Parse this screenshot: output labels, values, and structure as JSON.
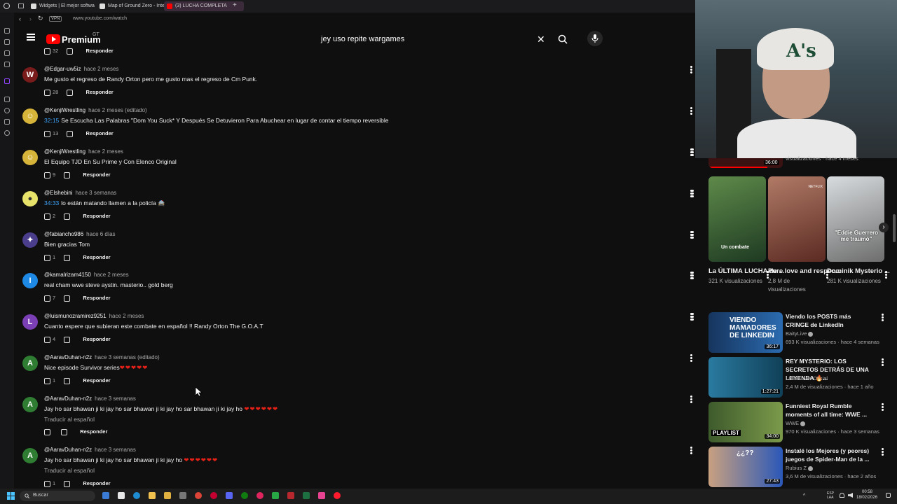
{
  "browser": {
    "tabs": [
      {
        "label": "Widgets | El mejor softwa",
        "color": "#e6e6e6"
      },
      {
        "label": "Map of Ground Zero - Inte",
        "color": "#e6e6e6"
      },
      {
        "label": "(3) LUCHA COMPLETA",
        "color": "#ff0000"
      }
    ],
    "vpn": "VPN",
    "url": "www.youtube.com/watch"
  },
  "header": {
    "logo_text": "Premium",
    "logo_sup": "GT",
    "search_value": "jey uso repite wargames",
    "clear_icon": "✕",
    "mic_icon": "🎤"
  },
  "comments": [
    {
      "author": "@Edgar-uw5iz",
      "time": "hace 2 meses",
      "timestamp": "",
      "text": "Me gusto el regreso de Randy Orton pero me gusto mas el regreso de Cm Punk.",
      "likes": "28",
      "reply": "Responder",
      "avatar_letter": "W",
      "avatar_color": "#7a1b1b"
    },
    {
      "author": "@KenjiWrestling",
      "time": "hace 2 meses (editado)",
      "timestamp": "32:15",
      "text": "Se Escucha Las Palabras \"Dom You Suck* Y Después Se Detuvieron Para Abuchear en lugar de contar el tiempo reversible",
      "likes": "13",
      "reply": "Responder",
      "avatar_letter": "☺",
      "avatar_color": "#d6b43a"
    },
    {
      "author": "@KenjiWrestling",
      "time": "hace 2 meses",
      "timestamp": "",
      "text": "El Equipo TJD En Su Prime y Con Elenco Original",
      "likes": "9",
      "reply": "Responder",
      "avatar_letter": "☺",
      "avatar_color": "#d6b43a"
    },
    {
      "author": "@Elshebini",
      "time": "hace 3 semanas",
      "timestamp": "34:33",
      "text": "lo están matando llamen a la policía 🚔",
      "likes": "2",
      "reply": "Responder",
      "avatar_letter": "●",
      "avatar_color": "#e7e26a"
    },
    {
      "author": "@fabiancho986",
      "time": "hace 6 días",
      "timestamp": "",
      "text": "Bien gracias Tom",
      "likes": "1",
      "reply": "Responder",
      "avatar_letter": "✦",
      "avatar_color": "#4a3e8c"
    },
    {
      "author": "@kamalrizam4150",
      "time": "hace 2 meses",
      "timestamp": "",
      "text": "real cham wwe steve aystin. masterio.. gold berg",
      "likes": "7",
      "reply": "Responder",
      "avatar_letter": "I",
      "avatar_color": "#1e88e5"
    },
    {
      "author": "@luismunozramirez9251",
      "time": "hace 2 meses",
      "timestamp": "",
      "text": "Cuanto espere que subieran este combate en español !! Randy Orton The G.O.A.T",
      "likes": "4",
      "reply": "Responder",
      "avatar_letter": "L",
      "avatar_color": "#7b3fb5"
    },
    {
      "author": "@AaravDuhan-n2z",
      "time": "hace 3 semanas (editado)",
      "timestamp": "",
      "text": "Nice episode Survivor series",
      "hearts": "❤❤❤❤❤",
      "likes": "1",
      "reply": "Responder",
      "avatar_letter": "A",
      "avatar_color": "#2e7d32"
    },
    {
      "author": "@AaravDuhan-n2z",
      "time": "hace 3 semanas",
      "timestamp": "",
      "text": "Jay ho sar bhawan ji ki jay ho sar bhawan ji ki jay ho sar bhawan ji ki jay ho",
      "hearts": "❤❤❤❤❤❤",
      "translate": "Traducir al español",
      "likes": "",
      "reply": "Responder",
      "avatar_letter": "A",
      "avatar_color": "#2e7d32"
    },
    {
      "author": "@AaravDuhan-n2z",
      "time": "hace 3 semanas",
      "timestamp": "",
      "text": "Jay ho sar bhawan ji ki jay ho sar bhawan ji ki jay ho",
      "hearts": "❤❤❤❤❤❤",
      "translate": "Traducir al español",
      "likes": "1",
      "reply": "Responder",
      "avatar_letter": "A",
      "avatar_color": "#2e7d32"
    }
  ],
  "top_partial": {
    "likes": "32",
    "reply": "Responder"
  },
  "top_rec_duration": "36:00",
  "top_rec_meta": "visualizaciones · hace 4 meses",
  "shorts": [
    {
      "title": "La ÚLTIMA LUCHA de ...",
      "views": "321 K visualizaciones",
      "overlay": "Un combate",
      "color": "#2f5d3a"
    },
    {
      "title": "Pure love and respec...",
      "views": "2,8 M de visualizaciones",
      "overlay": "",
      "color": "#8a5b50"
    },
    {
      "title": "Dominik Mysterio ...",
      "views": "281 K visualizaciones",
      "overlay": "\"Eddie Guerrero me traumó\"",
      "color": "#9aa0a6"
    }
  ],
  "recommendations": [
    {
      "title": "Viendo los POSTS más CRINGE de LinkedIn",
      "channel": "BaityLive",
      "verified": true,
      "meta": "693 K visualizaciones · hace 4 semanas",
      "duration": "36:17",
      "thumb_text": "VIENDO MAMADORES DE LINKEDIN",
      "color": "#1f4f8a"
    },
    {
      "title": "REY MYSTERIO: LOS SECRETOS DETRÁS DE UNA LEYENDA 🔥...",
      "channel": "Latin Lover Oficial",
      "verified": false,
      "meta": "2,4 M de visualizaciones · hace 1 año",
      "duration": "1:27:21",
      "thumb_text": "",
      "color": "#1b6a8a"
    },
    {
      "title": "Funniest Royal Rumble moments of all time: WWE ...",
      "channel": "WWE",
      "verified": true,
      "meta": "970 K visualizaciones · hace 3 semanas",
      "duration": "34:00",
      "thumb_text": "PLAYLIST",
      "color": "#4d6a3a"
    },
    {
      "title": "Instalé los Mejores (y peores) juegos de Spider-Man de la ...",
      "channel": "Rubius Z",
      "verified": true,
      "meta": "3,6 M de visualizaciones · hace 2 años",
      "duration": "27:43",
      "thumb_text": "¿¿??",
      "color": "#b8322c"
    }
  ],
  "taskbar": {
    "search_placeholder": "Buscar",
    "lang": "ESP\nLAA",
    "time": "00:58",
    "date": "18/02/2026"
  }
}
